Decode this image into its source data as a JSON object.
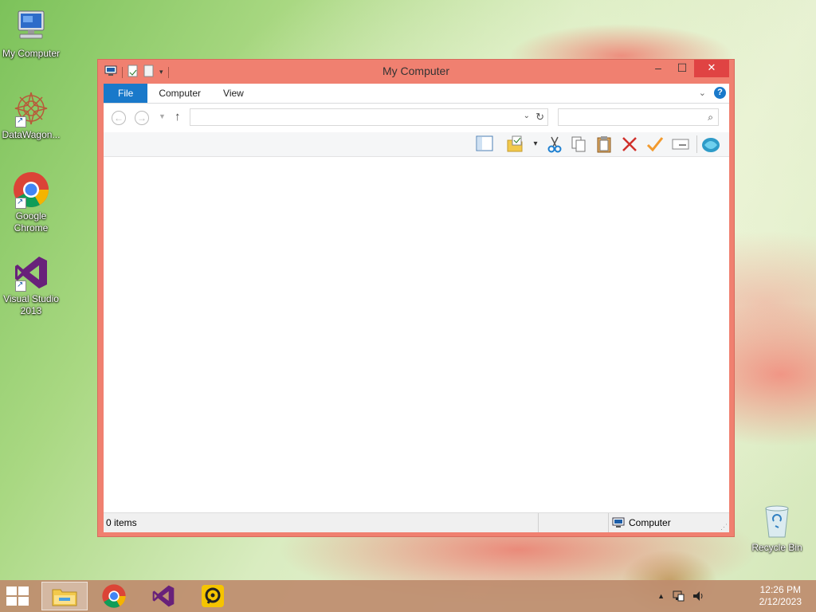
{
  "desktop": {
    "icons": [
      {
        "label": "My Computer"
      },
      {
        "label": "DataWagon..."
      },
      {
        "label": "Google Chrome"
      },
      {
        "label": "Visual Studio 2013"
      },
      {
        "label": "Recycle Bin"
      }
    ]
  },
  "window": {
    "title": "My Computer",
    "tabs": [
      {
        "label": "File"
      },
      {
        "label": "Computer"
      },
      {
        "label": "View"
      }
    ],
    "address": {
      "value": ""
    },
    "search": {
      "placeholder": ""
    },
    "toolbar_icons": [
      "pane-icon",
      "folder-check-icon",
      "dropdown-icon",
      "cut-icon",
      "copy-icon",
      "paste-icon",
      "delete-icon",
      "properties-icon",
      "rename-icon",
      "web-icon"
    ],
    "status": {
      "items_count": "0 items",
      "location": "Computer"
    }
  },
  "taskbar": {
    "apps": [
      "file-explorer",
      "google-chrome",
      "visual-studio",
      "teamviewer-like"
    ],
    "clock": {
      "time": "12:26 PM",
      "date": "2/12/2023"
    }
  },
  "colors": {
    "window_frame": "#f08070",
    "file_tab": "#1979ca",
    "close_button": "#e04343"
  }
}
